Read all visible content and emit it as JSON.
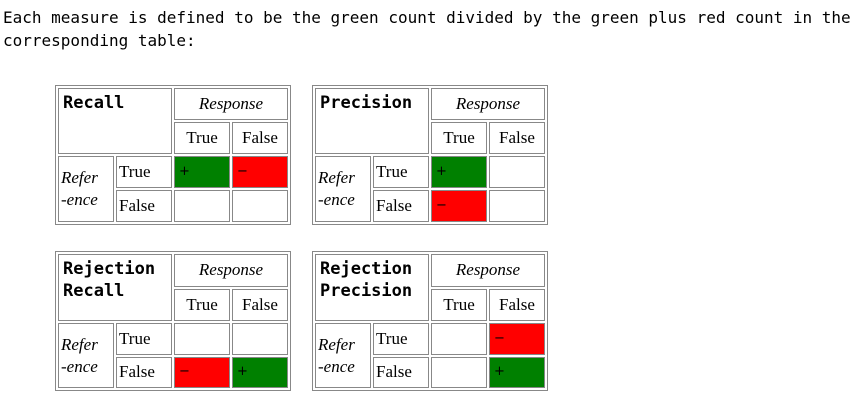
{
  "intro": "Each measure is defined to be the green count divided by the green plus red count in the corresponding table:",
  "labels": {
    "response": "Response",
    "true": "True",
    "false": "False",
    "reference_top": "Refer",
    "reference_bottom": "-ence"
  },
  "colors": {
    "green": "#008000",
    "red": "#ff0000",
    "border": "#888888"
  },
  "tables": [
    {
      "title_line1": "Recall",
      "title_line2": "",
      "cells": {
        "tt": {
          "color": "green",
          "mark": "+"
        },
        "tf": {
          "color": "red",
          "mark": "−"
        },
        "ft": {
          "color": "",
          "mark": ""
        },
        "ff": {
          "color": "",
          "mark": ""
        }
      }
    },
    {
      "title_line1": "Precision",
      "title_line2": "",
      "cells": {
        "tt": {
          "color": "green",
          "mark": "+"
        },
        "tf": {
          "color": "",
          "mark": ""
        },
        "ft": {
          "color": "red",
          "mark": "−"
        },
        "ff": {
          "color": "",
          "mark": ""
        }
      }
    },
    {
      "title_line1": "Rejection",
      "title_line2": "Recall",
      "cells": {
        "tt": {
          "color": "",
          "mark": ""
        },
        "tf": {
          "color": "",
          "mark": ""
        },
        "ft": {
          "color": "red",
          "mark": "−"
        },
        "ff": {
          "color": "green",
          "mark": "+"
        }
      }
    },
    {
      "title_line1": "Rejection",
      "title_line2": "Precision",
      "cells": {
        "tt": {
          "color": "",
          "mark": ""
        },
        "tf": {
          "color": "red",
          "mark": "−"
        },
        "ft": {
          "color": "",
          "mark": ""
        },
        "ff": {
          "color": "green",
          "mark": "+"
        }
      }
    }
  ]
}
